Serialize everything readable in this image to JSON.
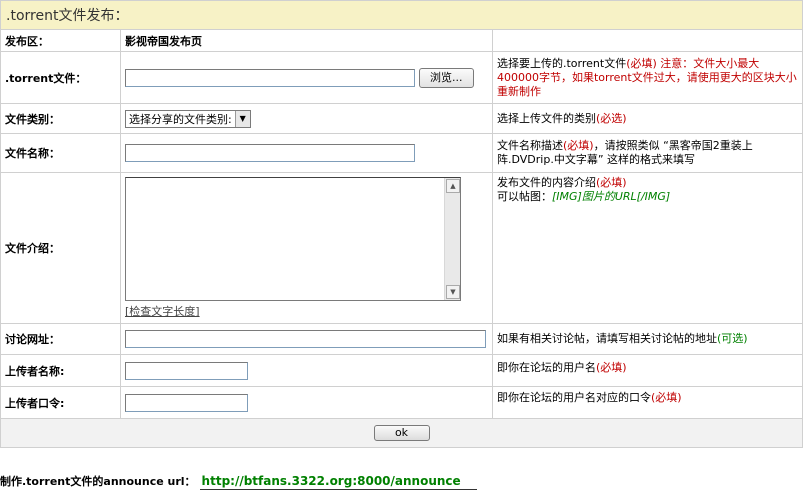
{
  "header": {
    "title": ".torrent文件发布："
  },
  "section": {
    "label": "发布区：",
    "value": "影视帝国发布页"
  },
  "torrent": {
    "label": ".torrent文件：",
    "browse_label": "浏览...",
    "hint_main": "选择要上传的.torrent文件",
    "hint_required": "(必填)",
    "hint_warning": "注意：文件大小最大400000字节，如果torrent文件过大，请使用更大的区块大小重新制作"
  },
  "category": {
    "label": "文件类别：",
    "selected": "选择分享的文件类别:",
    "hint_main": "选择上传文件的类别",
    "hint_tag": "(必选)"
  },
  "filename": {
    "label": "文件名称：",
    "hint_pre": "文件名称描述",
    "hint_tag": "(必填)",
    "hint_post": "，请按照类似 “黑客帝国2重装上阵.DVDrip.中文字幕” 这样的格式来填写"
  },
  "description": {
    "label": "文件介绍：",
    "check_link": "[检查文字长度]",
    "hint_main": "发布文件的内容介绍",
    "hint_tag": "(必填)",
    "hint_line2": "可以帖图：",
    "hint_img": "[IMG]图片的URL[/IMG]"
  },
  "discussion": {
    "label": "讨论网址：",
    "hint_main": "如果有相关讨论帖，请填写相关讨论帖的地址",
    "hint_tag": "(可选)"
  },
  "uploader": {
    "label": "上传者名称:",
    "hint_main": "即你在论坛的用户名",
    "hint_tag": "(必填)"
  },
  "password": {
    "label": "上传者口令:",
    "hint_main": "即你在论坛的用户名对应的口令",
    "hint_tag": "(必填)"
  },
  "submit": {
    "label": "ok"
  },
  "announce": {
    "label": "制作.torrent文件的announce url：",
    "url": "http://btfans.3322.org:8000/announce"
  }
}
